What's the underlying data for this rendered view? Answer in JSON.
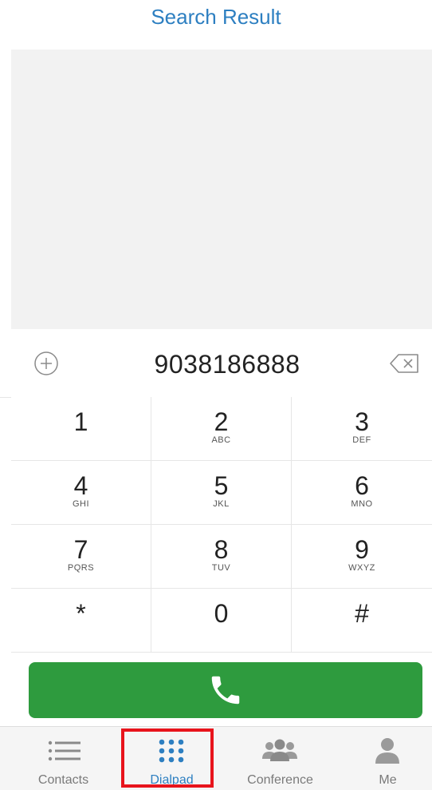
{
  "header": {
    "title": "Search Result"
  },
  "dial": {
    "number": "9038186888"
  },
  "keypad": {
    "keys": [
      {
        "digit": "1",
        "letters": ""
      },
      {
        "digit": "2",
        "letters": "ABC"
      },
      {
        "digit": "3",
        "letters": "DEF"
      },
      {
        "digit": "4",
        "letters": "GHI"
      },
      {
        "digit": "5",
        "letters": "JKL"
      },
      {
        "digit": "6",
        "letters": "MNO"
      },
      {
        "digit": "7",
        "letters": "PQRS"
      },
      {
        "digit": "8",
        "letters": "TUV"
      },
      {
        "digit": "9",
        "letters": "WXYZ"
      },
      {
        "digit": "*",
        "letters": ""
      },
      {
        "digit": "0",
        "letters": ""
      },
      {
        "digit": "#",
        "letters": ""
      }
    ]
  },
  "call": {
    "icon": "phone-icon",
    "color": "#2e9b3e"
  },
  "tabs": [
    {
      "label": "Contacts",
      "icon": "list-icon",
      "active": false
    },
    {
      "label": "Dialpad",
      "icon": "dialpad-icon",
      "active": true
    },
    {
      "label": "Conference",
      "icon": "group-icon",
      "active": false
    },
    {
      "label": "Me",
      "icon": "person-icon",
      "active": false
    }
  ],
  "colors": {
    "accent": "#2d7fc1",
    "call_green": "#2e9b3e",
    "highlight_red": "#e8141c"
  }
}
